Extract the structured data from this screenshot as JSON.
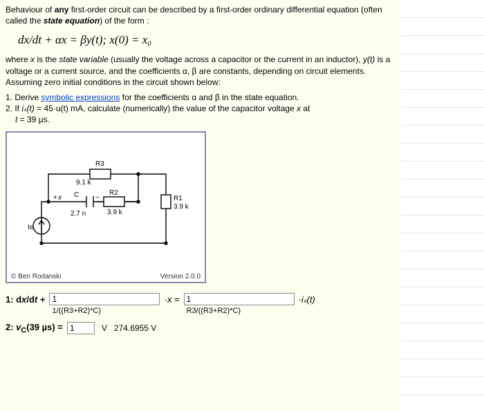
{
  "intro": {
    "line1_a": "Behaviour of ",
    "line1_b": "any",
    "line1_c": " first-order circuit can be described by a first-order ordinary differential equation (often called the ",
    "line1_d": "state equation",
    "line1_e": ") of the form :"
  },
  "equation": "dx/dt + αx = βy(t);  x(0) = x₀",
  "where": {
    "a": "where ",
    "b": "x",
    "c": " is the ",
    "d": "state variable",
    "e": " (usually the voltage across a capacitor or the current in an inductor), ",
    "f": "y(t)",
    "g": " is a voltage or a current source, and the coefficients α, β are constants, depending on circuit elements. Assuming zero initial conditions in the circuit shown below:"
  },
  "tasks": {
    "t1a": "1. Derive ",
    "t1b": "symbolic expressions",
    "t1c": " for the coefficients α and β in the state equation.",
    "t2a": "2. If ",
    "t2b": "iₛ(t)",
    "t2c": " = 45·u(t) mA, calculate (numerically) the value of the capacitor voltage ",
    "t2d": "x",
    "t2e": " at",
    "t3a": "t",
    "t3b": " = 39 µs."
  },
  "circuit": {
    "R3": "R3",
    "R3v": "9.1 k",
    "R2": "R2",
    "R2v": "3.9 k",
    "R1": "R1",
    "R1v": "3.9 k",
    "C": "C",
    "Cv": "2.7 n",
    "Is": "Is",
    "xlab": "x",
    "plus": "+",
    "minus": "−",
    "credit": "© Ben Rodanski",
    "version": "Version 2.0.0"
  },
  "answers": {
    "row1_label_a": "1: d",
    "row1_label_b": "x",
    "row1_label_c": "/d",
    "row1_label_d": "t",
    "row1_label_e": " + ",
    "alpha_input": "1",
    "alpha_sub": "1/((R3+R2)*C)",
    "midseg_a": "·",
    "midseg_b": "x",
    "midseg_c": " = ",
    "beta_input": "1",
    "beta_sub": "R3/((R3+R2)*C)",
    "tail": "·iₛ(t)",
    "row2_label_a": "2: ",
    "row2_label_b": "v",
    "row2_label_c": "C",
    "row2_label_d": "(39 µs) = ",
    "vc_input": "1",
    "vc_unit": "V",
    "vc_value": "274.6955 V"
  },
  "chart_data": {
    "type": "table",
    "title": "First-order RC circuit parameters",
    "rows": [
      {
        "component": "R1",
        "value": 3.9,
        "unit": "kΩ"
      },
      {
        "component": "R2",
        "value": 3.9,
        "unit": "kΩ"
      },
      {
        "component": "R3",
        "value": 9.1,
        "unit": "kΩ"
      },
      {
        "component": "C",
        "value": 2.7,
        "unit": "nF"
      },
      {
        "component": "Is",
        "value": 45,
        "unit": "mA (step u(t))"
      },
      {
        "quantity": "t",
        "value": 39,
        "unit": "µs"
      },
      {
        "quantity": "α",
        "expression": "1/((R3+R2)*C)"
      },
      {
        "quantity": "β",
        "expression": "R3/((R3+R2)*C)"
      },
      {
        "quantity": "v_C(39 µs)",
        "value": 274.6955,
        "unit": "V"
      }
    ]
  }
}
